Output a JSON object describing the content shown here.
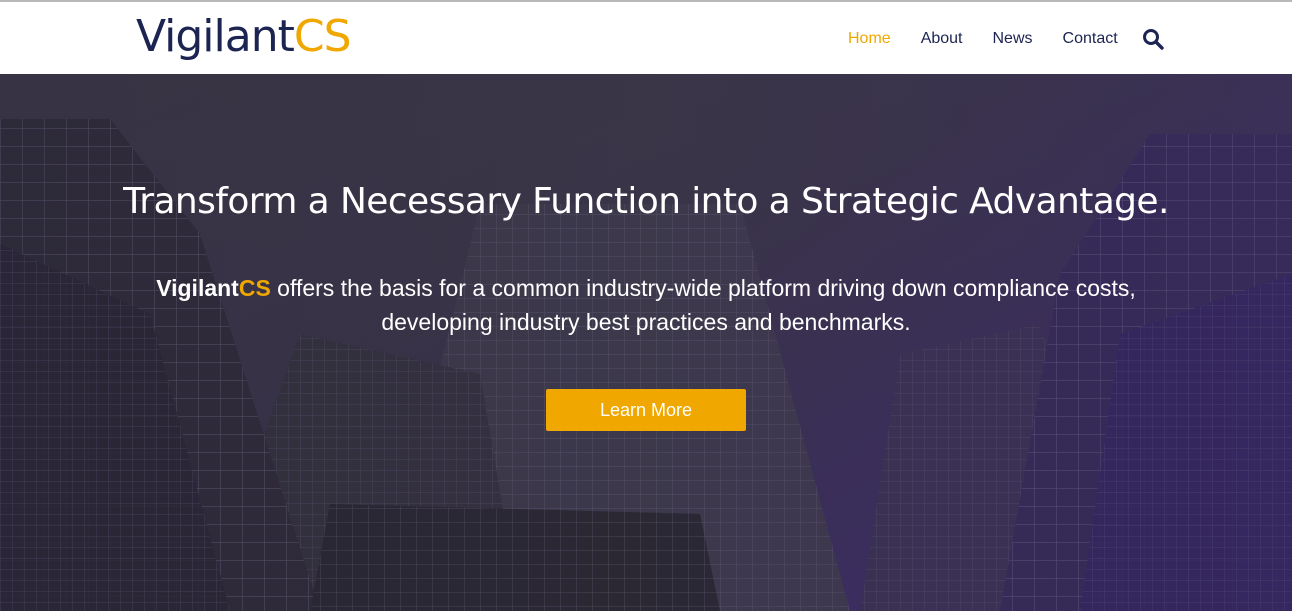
{
  "brand": {
    "logo_part1": "Vigilant",
    "logo_part2": "CS"
  },
  "nav": {
    "items": [
      {
        "label": "Home",
        "active": true
      },
      {
        "label": "About",
        "active": false
      },
      {
        "label": "News",
        "active": false
      },
      {
        "label": "Contact",
        "active": false
      }
    ],
    "search_icon": "search-icon"
  },
  "hero": {
    "title": "Transform a Necessary Function into a Strategic Advantage.",
    "brand_part1": "Vigilant",
    "brand_part2": "CS",
    "text_line1": " offers the basis for a common industry-wide platform driving down compliance costs,",
    "text_line2": "developing industry best practices and benchmarks.",
    "cta_label": "Learn More",
    "background": "buildings-skyline-photo"
  },
  "colors": {
    "accent": "#f0a800",
    "navy": "#1c2452",
    "hero_tint": "#3d2c66"
  }
}
